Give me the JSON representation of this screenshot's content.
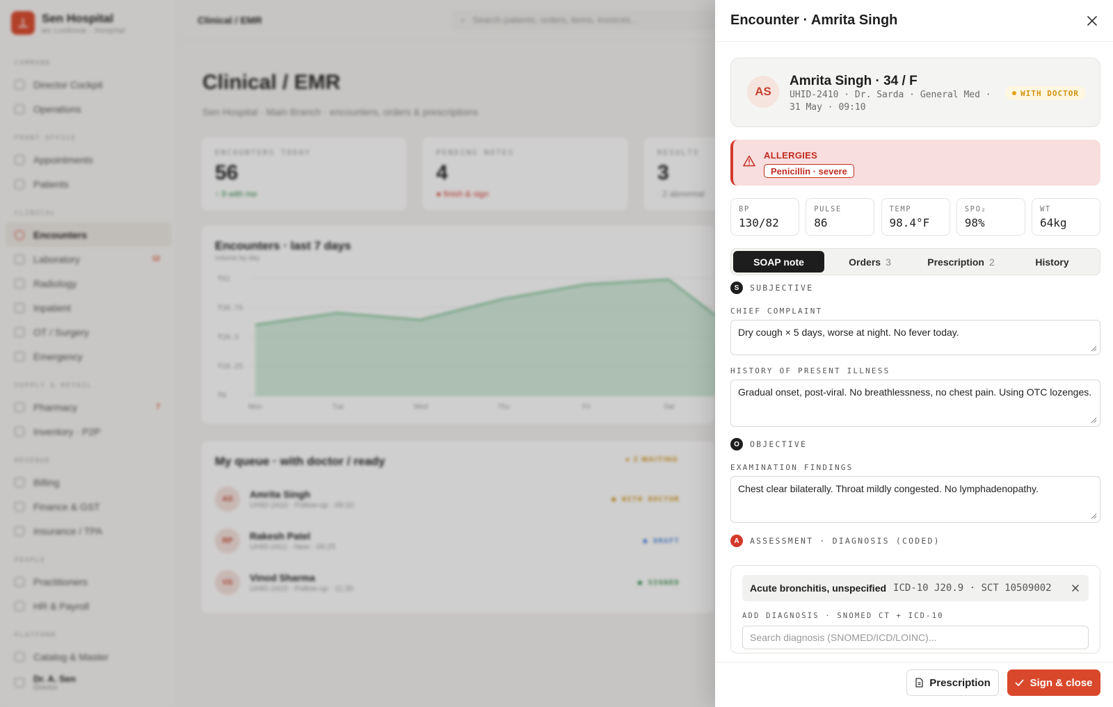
{
  "brand": {
    "name": "Sen Hospital",
    "sub": "ws Lucknow · Hospital"
  },
  "topbar": {
    "breadcrumb_prefix": "Clinical /",
    "breadcrumb_current": "Clinical / EMR",
    "search_placeholder": "Search patients, orders, items, invoices..."
  },
  "sidebar": {
    "sections": [
      {
        "label": "COMMAND",
        "items": [
          {
            "label": "Director Cockpit"
          },
          {
            "label": "Operations"
          }
        ]
      },
      {
        "label": "FRONT OFFICE",
        "items": [
          {
            "label": "Appointments"
          },
          {
            "label": "Patients"
          }
        ]
      },
      {
        "label": "CLINICAL",
        "items": [
          {
            "label": "Encounters",
            "active": true
          },
          {
            "label": "Laboratory",
            "badge": "12"
          },
          {
            "label": "Radiology"
          },
          {
            "label": "Inpatient"
          },
          {
            "label": "OT / Surgery"
          },
          {
            "label": "Emergency"
          }
        ]
      },
      {
        "label": "SUPPLY & RETAIL",
        "items": [
          {
            "label": "Pharmacy",
            "badge": "7"
          },
          {
            "label": "Inventory · P2P"
          }
        ]
      },
      {
        "label": "REVENUE",
        "items": [
          {
            "label": "Billing"
          },
          {
            "label": "Finance & GST"
          },
          {
            "label": "Insurance / TPA"
          }
        ]
      },
      {
        "label": "PEOPLE",
        "items": [
          {
            "label": "Practitioners"
          },
          {
            "label": "HR & Payroll"
          }
        ]
      },
      {
        "label": "PLATFORM",
        "items": [
          {
            "label": "Catalog & Master"
          }
        ]
      }
    ],
    "user": {
      "name": "Dr. A. Sen",
      "role": "Director"
    }
  },
  "main": {
    "title": "Clinical / EMR",
    "subtitle": "Sen Hospital · Main Branch · encounters, orders & prescriptions",
    "stats": [
      {
        "label": "ENCOUNTERS TODAY",
        "value": "56",
        "note": "↑ 9 with me",
        "note_color": "#2f8a4a"
      },
      {
        "label": "PENDING NOTES",
        "value": "4",
        "note": "● finish & sign",
        "note_color": "#d3392b"
      },
      {
        "label": "RESULTS",
        "value": "3",
        "note": "· 2 abnormal",
        "note_color": "#888888"
      }
    ],
    "chart": {
      "title": "Encounters · last 7 days",
      "subtitle": "volume by day",
      "y_ticks": [
        "₹41",
        "₹30.75",
        "₹20.5",
        "₹10.25",
        "₹0"
      ],
      "categories": [
        "Mon",
        "Tue",
        "Wed",
        "Thu",
        "Fri",
        "Sat"
      ]
    },
    "queue": {
      "title": "My queue · with doctor / ready",
      "badge": "● 2 WAITING",
      "rows": [
        {
          "initials": "AS",
          "name": "Amrita Singh",
          "meta": "UHID-2410 · Follow-up · 09:10",
          "status": "● WITH DOCTOR",
          "status_color": "#cf9210"
        },
        {
          "initials": "RP",
          "name": "Rakesh Patel",
          "meta": "UHID-2411 · New · 09:25",
          "status": "● DRAFT",
          "status_color": "#3d7dd8"
        },
        {
          "initials": "VS",
          "name": "Vinod Sharma",
          "meta": "UHID-2415 · Follow-up · 11:30",
          "status": "● SIGNED",
          "status_color": "#2f8a4a"
        }
      ]
    }
  },
  "drawer": {
    "title": "Encounter · Amrita Singh",
    "patient": {
      "initials": "AS",
      "name": "Amrita Singh · 34 / F",
      "meta": "UHID-2410 · Dr. Sarda · General Med · 31 May · 09:10",
      "status": "WITH DOCTOR"
    },
    "allergies": {
      "label": "ALLERGIES",
      "items": [
        "Penicillin · severe"
      ]
    },
    "vitals": [
      {
        "label": "BP",
        "value": "130/82"
      },
      {
        "label": "PULSE",
        "value": "86"
      },
      {
        "label": "TEMP",
        "value": "98.4°F"
      },
      {
        "label": "SPO₂",
        "value": "98%"
      },
      {
        "label": "WT",
        "value": "64kg"
      }
    ],
    "tabs": [
      {
        "label": "SOAP note",
        "count": "",
        "active": true
      },
      {
        "label": "Orders",
        "count": "3"
      },
      {
        "label": "Prescription",
        "count": "2"
      },
      {
        "label": "History",
        "count": ""
      }
    ],
    "subjective": {
      "letter": "S",
      "heading": "SUBJECTIVE",
      "chief_complaint_label": "CHIEF COMPLAINT",
      "chief_complaint": "Dry cough × 5 days, worse at night. No fever today.",
      "hpi_label": "HISTORY OF PRESENT ILLNESS",
      "hpi": "Gradual onset, post-viral. No breathlessness, no chest pain. Using OTC lozenges."
    },
    "objective": {
      "letter": "O",
      "heading": "OBJECTIVE",
      "exam_label": "EXAMINATION FINDINGS",
      "exam": "Chest clear bilaterally. Throat mildly congested. No lymphadenopathy."
    },
    "assessment": {
      "letter": "A",
      "heading": "ASSESSMENT · DIAGNOSIS (CODED)",
      "diagnosis_name": "Acute bronchitis, unspecified",
      "diagnosis_codes": "ICD-10 J20.9 · SCT 10509002",
      "add_label": "ADD DIAGNOSIS · SNOMED CT + ICD-10",
      "search_placeholder": "Search diagnosis (SNOMED/ICD/LOINC)..."
    },
    "footer": {
      "secondary_label": "Prescription",
      "primary_label": "Sign & close"
    }
  },
  "colors": {
    "accent": "#d9482b",
    "danger": "#d3392b",
    "warning": "#e0a21b"
  }
}
